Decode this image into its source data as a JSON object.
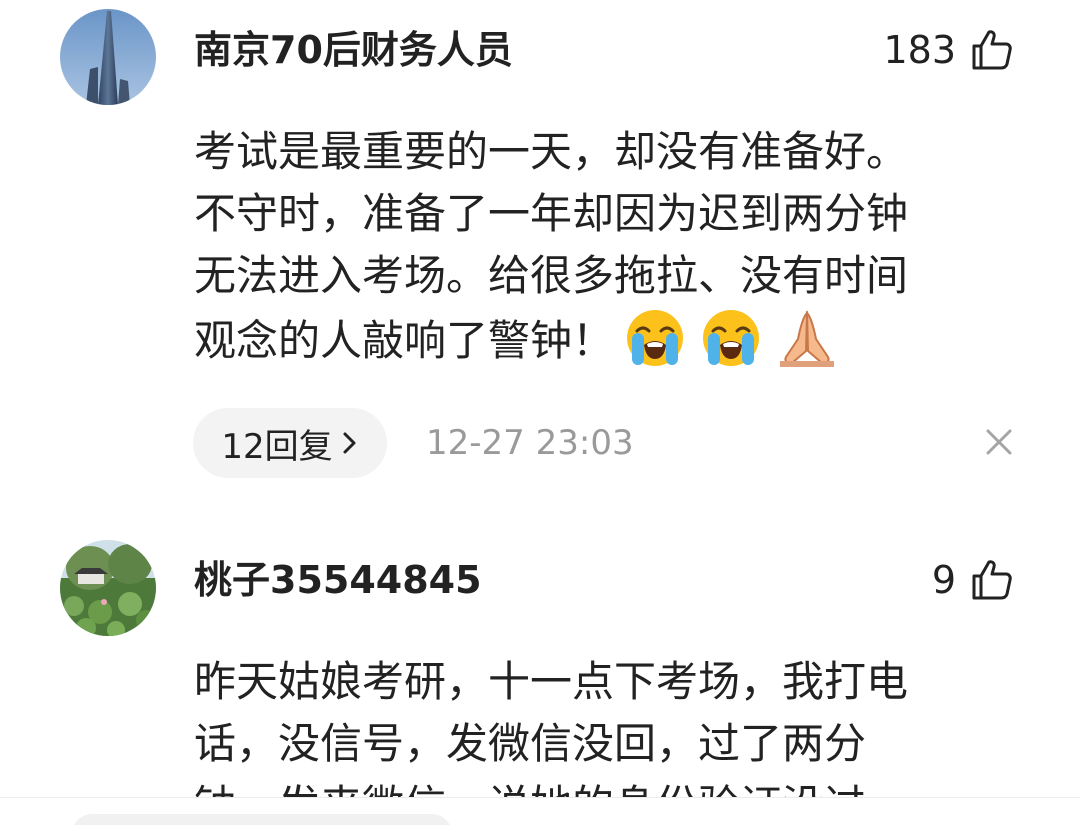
{
  "comments": [
    {
      "username": "南京70后财务人员",
      "likes": "183",
      "content_lines": [
        "考试是最重要的一天，却没有准备好。",
        "不守时，准备了一年却因为迟到两分钟",
        "无法进入考场。给很多拖拉、没有时间",
        "观念的人敲响了警钟！"
      ],
      "emojis": [
        "😭",
        "😭",
        "🙏"
      ],
      "reply_label": "12回复",
      "timestamp": "12-27 23:03"
    },
    {
      "username": "桃子35544845",
      "likes": "9",
      "content_lines": [
        "昨天姑娘考研，十一点下考场，我打电",
        "话，没信号，发微信没回，过了两分",
        "钟，发来微信，说她的身份验证没过"
      ]
    }
  ],
  "icons": {
    "like": "thumbs-up-outline-icon",
    "reply_arrow": "chevron-right-icon",
    "dismiss": "close-icon",
    "emoji_cry": "loudly-crying-face-emoji",
    "emoji_pray": "folded-hands-emoji"
  },
  "colors": {
    "text": "#222222",
    "muted": "#9a9a9a",
    "pill_bg": "#f3f3f3"
  }
}
